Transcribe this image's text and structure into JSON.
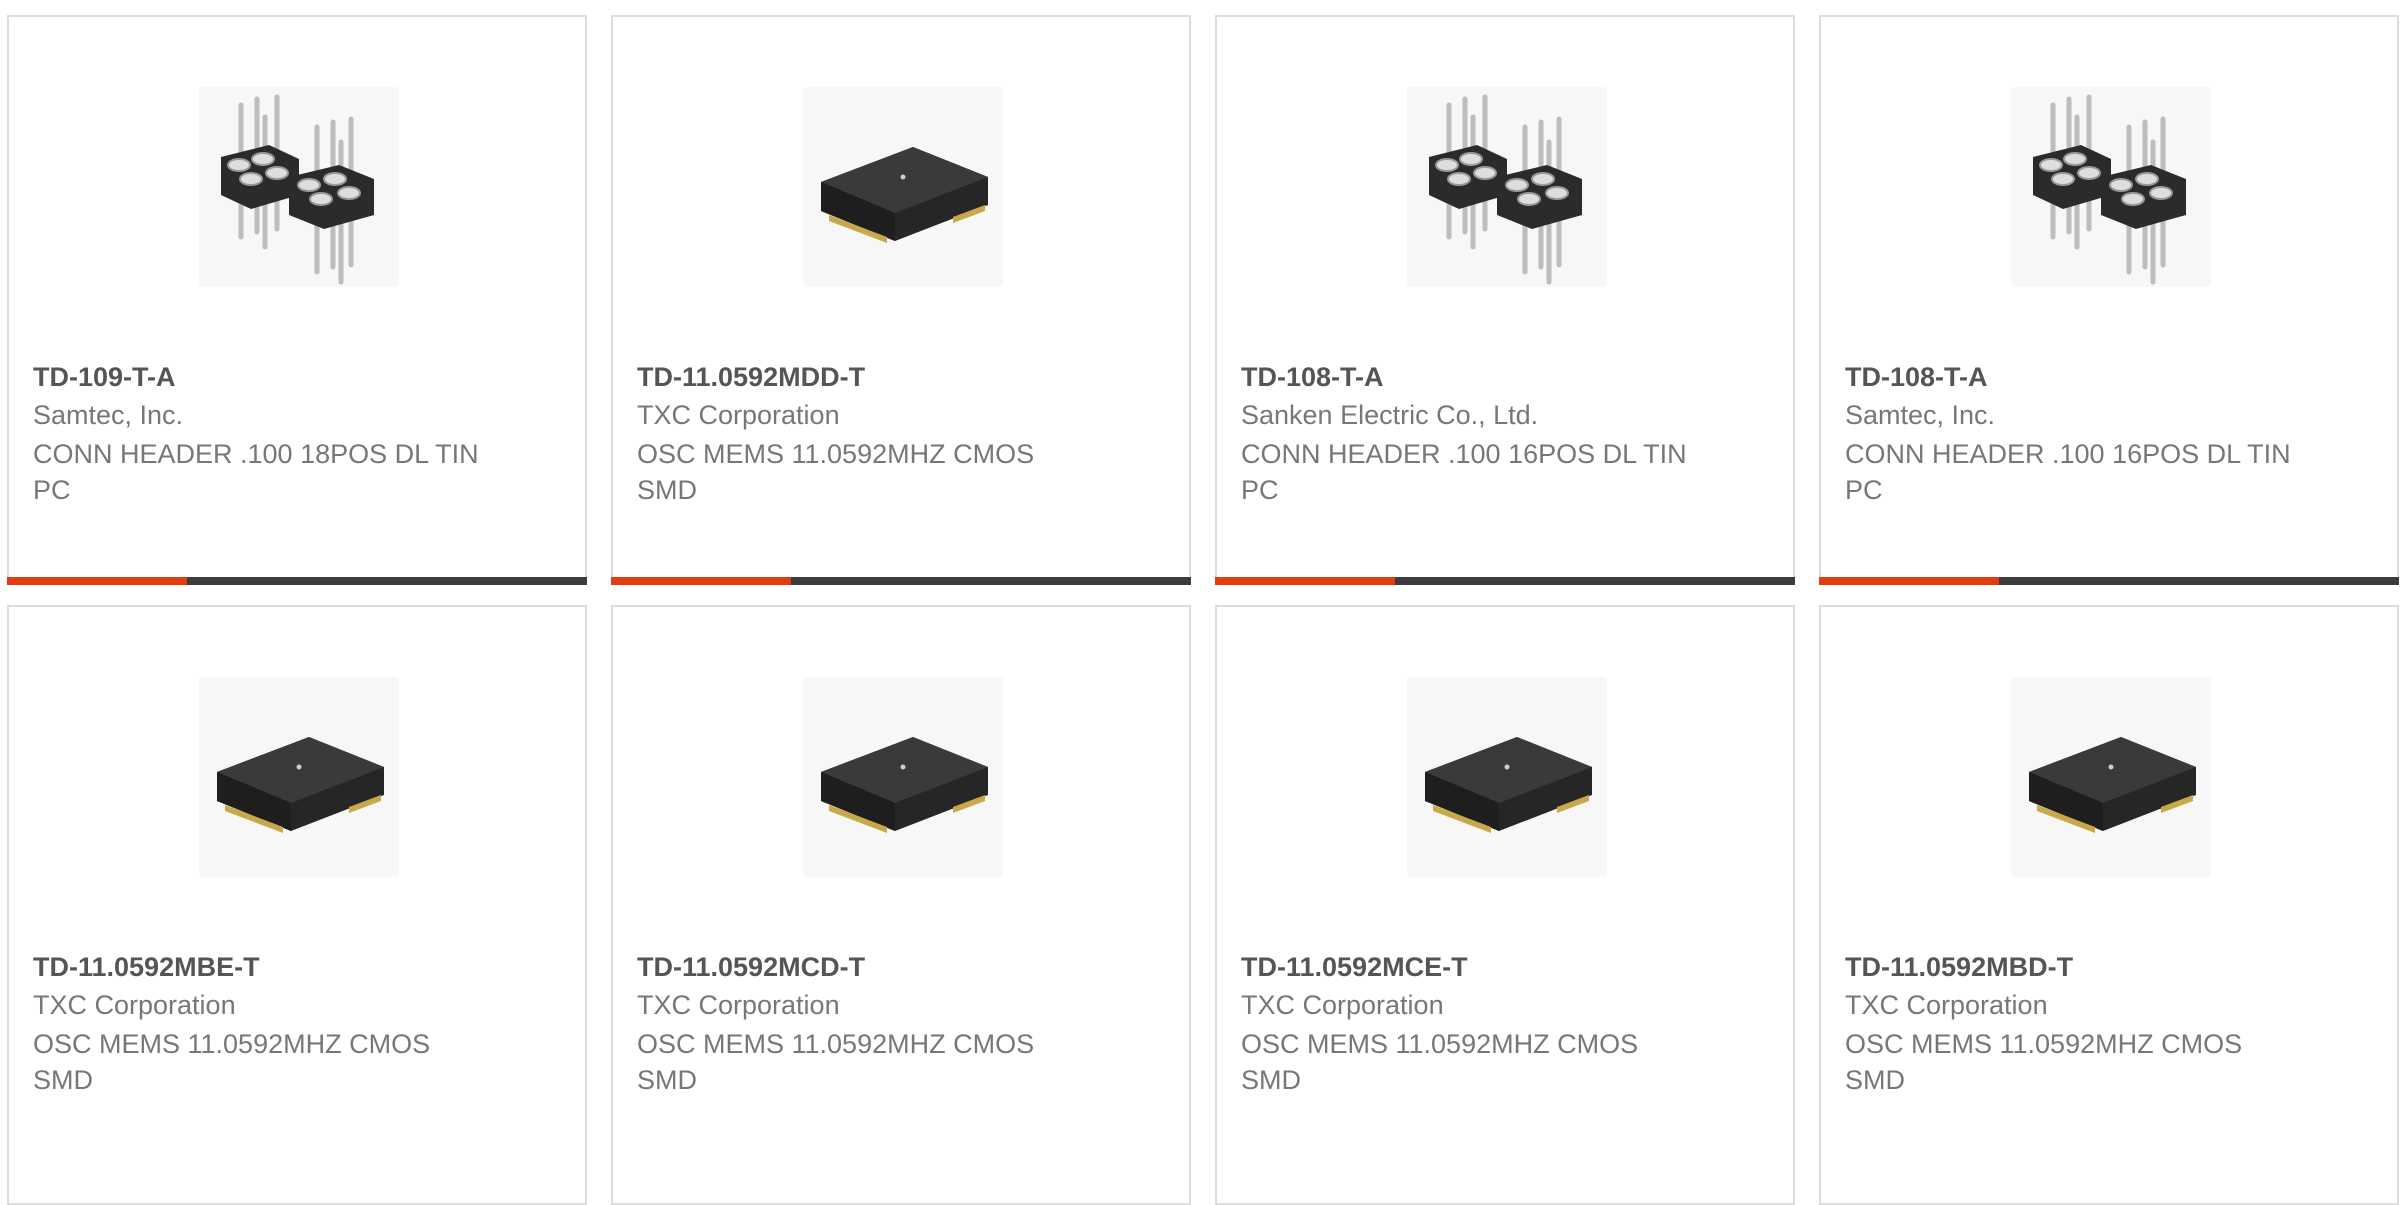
{
  "products": [
    {
      "part_number": "TD-109-T-A",
      "manufacturer": "Samtec, Inc.",
      "description": "CONN HEADER .100 18POS DL TIN PC",
      "image": "pin-header-icon",
      "progress": 0.31
    },
    {
      "part_number": "TD-11.0592MDD-T",
      "manufacturer": "TXC Corporation",
      "description": "OSC MEMS 11.0592MHZ CMOS SMD",
      "image": "oscillator-chip-icon",
      "progress": 0.31
    },
    {
      "part_number": "TD-108-T-A",
      "manufacturer": "Sanken Electric Co., Ltd.",
      "description": "CONN HEADER .100 16POS DL TIN PC",
      "image": "pin-header-icon",
      "progress": 0.31
    },
    {
      "part_number": "TD-108-T-A",
      "manufacturer": "Samtec, Inc.",
      "description": "CONN HEADER .100 16POS DL TIN PC",
      "image": "pin-header-icon",
      "progress": 0.31
    },
    {
      "part_number": "TD-11.0592MBE-T",
      "manufacturer": "TXC Corporation",
      "description": "OSC MEMS 11.0592MHZ CMOS SMD",
      "image": "oscillator-chip-icon"
    },
    {
      "part_number": "TD-11.0592MCD-T",
      "manufacturer": "TXC Corporation",
      "description": "OSC MEMS 11.0592MHZ CMOS SMD",
      "image": "oscillator-chip-icon"
    },
    {
      "part_number": "TD-11.0592MCE-T",
      "manufacturer": "TXC Corporation",
      "description": "OSC MEMS 11.0592MHZ CMOS SMD",
      "image": "oscillator-chip-icon"
    },
    {
      "part_number": "TD-11.0592MBD-T",
      "manufacturer": "TXC Corporation",
      "description": "OSC MEMS 11.0592MHZ CMOS SMD",
      "image": "oscillator-chip-icon"
    }
  ],
  "colors": {
    "accent": "#e23c12",
    "bar_dark": "#3c3c3c",
    "border": "#dddddd",
    "part_text": "#555555",
    "body_text": "#777777"
  }
}
